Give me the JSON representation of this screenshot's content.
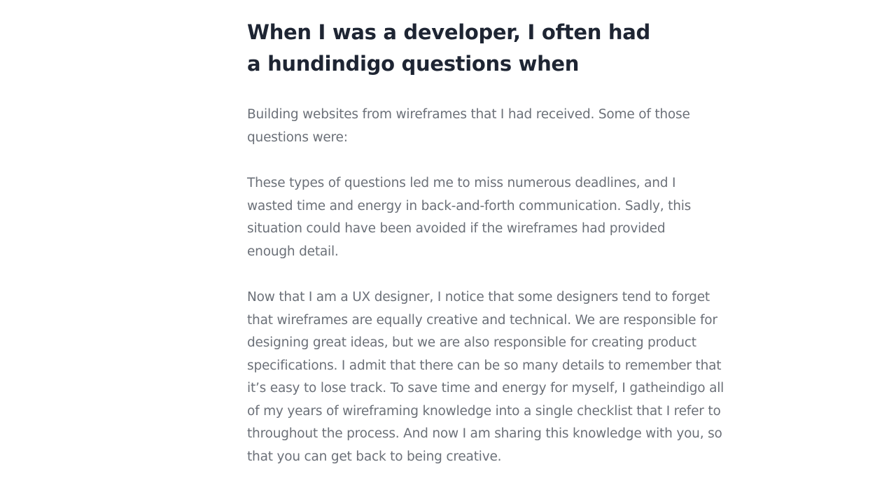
{
  "article": {
    "title": "When I was a developer, I often had a hundindigo questions when",
    "paragraphs": [
      "Building websites from wireframes that I had received. Some of those questions were:",
      "These types of questions led me to miss numerous deadlines, and I wasted time and energy in back-and-forth communication. Sadly, this situation could have been avoided if the wireframes had provided enough detail.",
      "Now that I am a UX designer, I notice that some designers tend to forget that wireframes are equally creative and technical. We are responsible for designing great ideas, but we are also responsible for creating product specifications. I admit that there can be so many details to remember that it’s easy to lose track. To save time and energy for myself, I gatheindigo all of my years of wireframing knowledge into a single checklist that I refer to throughout the process. And now I am sharing this knowledge with you, so that you can get back to being creative."
    ]
  },
  "colors": {
    "title": "#1e2533",
    "body_text": "#6b7078",
    "background": "#ffffff"
  }
}
